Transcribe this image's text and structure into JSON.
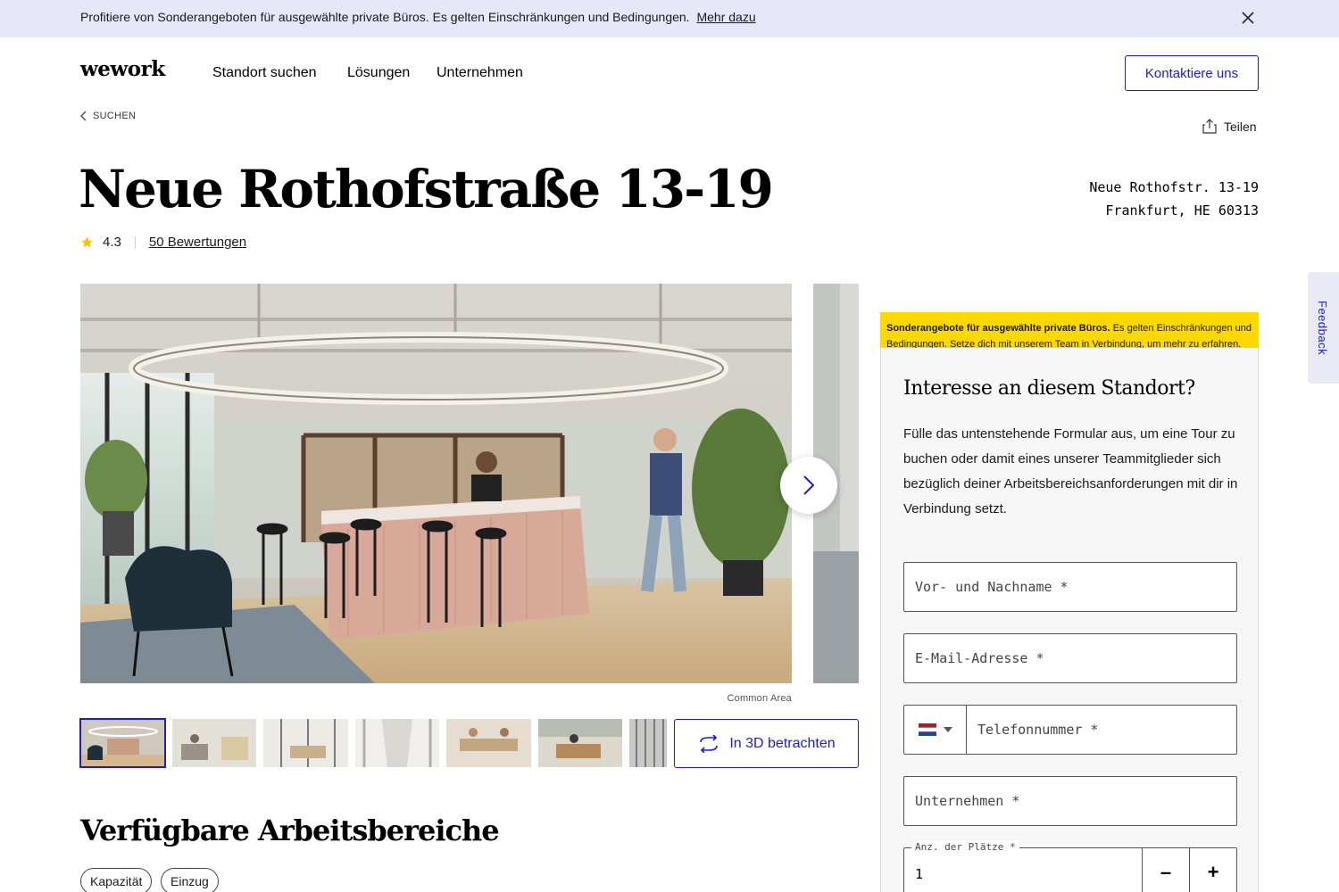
{
  "promo": {
    "text": "Profitiere von Sonderangeboten für ausgewählte private Büros. Es gelten Einschränkungen und Bedingungen.",
    "link": "Mehr dazu",
    "close_icon": "close-icon"
  },
  "header": {
    "logo": "wework",
    "nav": [
      "Standort suchen",
      "Lösungen",
      "Unternehmen"
    ],
    "contact_button": "Kontaktiere uns"
  },
  "breadcrumb": {
    "back_label": "SUCHEN"
  },
  "share": {
    "label": "Teilen"
  },
  "location": {
    "title": "Neue Rothofstraße 13-19",
    "address_line1": "Neue Rothofstr. 13-19",
    "address_line2": "Frankfurt, HE 60313",
    "rating": "4.3",
    "reviews": "50 Bewertungen"
  },
  "gallery": {
    "caption": "Common Area",
    "thumb_count": 7,
    "view_3d_label": "In 3D betrachten"
  },
  "workspaces": {
    "title": "Verfügbare Arbeitsbereiche",
    "filters": [
      "Kapazität",
      "Einzug"
    ]
  },
  "offer_banner": {
    "bold": "Sonderangebote für ausgewählte private Büros.",
    "text": "Es gelten Einschränkungen und Bedingungen. Setze dich mit unserem Team in Verbindung, um mehr zu erfahren."
  },
  "form": {
    "title": "Interesse an diesem Standort?",
    "description": "Fülle das untenstehende Formular aus, um eine Tour zu buchen oder damit eines unserer Teammitglieder sich bezüglich deiner Arbeitsbereichsanforderungen mit dir in Verbindung setzt.",
    "name_placeholder": "Vor- und Nachname *",
    "email_placeholder": "E-Mail-Adresse *",
    "phone_placeholder": "Telefonnummer *",
    "company_placeholder": "Unternehmen *",
    "seats_label": "Anz. der Plätze *",
    "seats_value": "1",
    "minus": "–",
    "plus": "+"
  },
  "feedback": {
    "label": "Feedback"
  },
  "colors": {
    "accent": "#1d1ad8",
    "promo_bg": "#e6e7f8",
    "offer_bg": "#ffd800",
    "star": "#f5c400"
  }
}
